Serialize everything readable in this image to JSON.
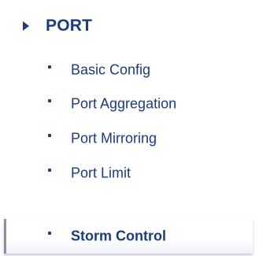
{
  "section": {
    "label": "PORT",
    "icon": "triangle-right-icon",
    "expanded": true
  },
  "items": [
    {
      "label": "Basic Config",
      "active": false
    },
    {
      "label": "Port Aggregation",
      "active": false
    },
    {
      "label": "Port Mirroring",
      "active": false
    },
    {
      "label": "Port Limit",
      "active": false
    },
    {
      "label": "Storm Control",
      "active": true
    }
  ],
  "colors": {
    "text": "#1a3a8a",
    "active_border": "#8a8fa6"
  }
}
